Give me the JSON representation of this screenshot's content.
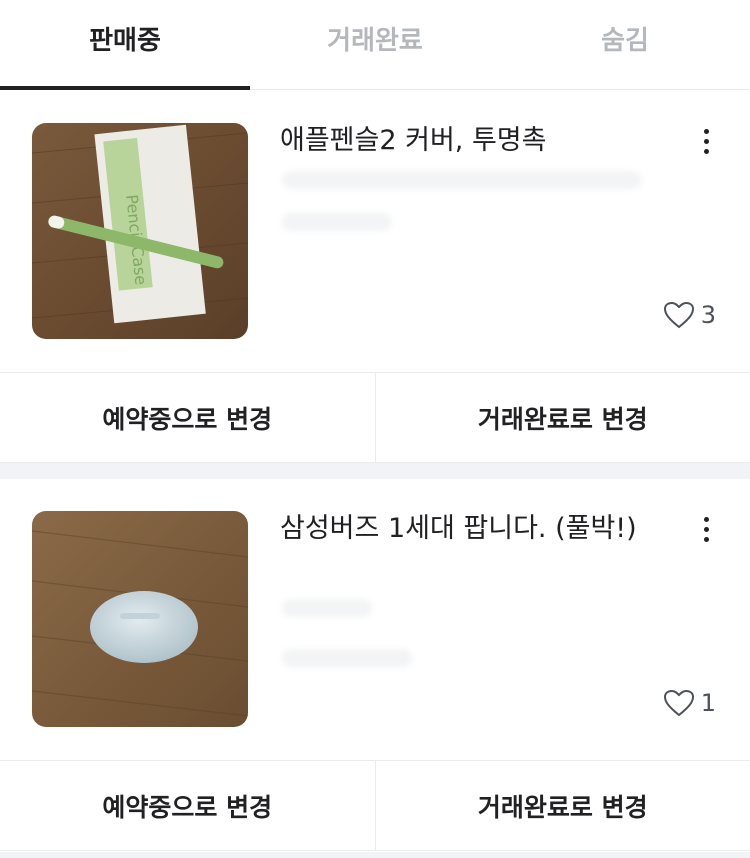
{
  "tabs": [
    {
      "label": "판매중",
      "active": true
    },
    {
      "label": "거래완료",
      "active": false
    },
    {
      "label": "숨김",
      "active": false
    }
  ],
  "items": [
    {
      "title": "애플펜슬2 커버, 투명촉",
      "likes": "3",
      "image_icon": "pencil-case-photo",
      "actions": {
        "reserve": "예약중으로 변경",
        "complete": "거래완료로 변경"
      }
    },
    {
      "title": "삼성버즈 1세대 팝니다. (풀박!)",
      "likes": "1",
      "image_icon": "earbuds-case-photo",
      "actions": {
        "reserve": "예약중으로 변경",
        "complete": "거래완료로 변경"
      }
    }
  ],
  "colors": {
    "text": "#212124",
    "inactive_tab": "#b4b8bd",
    "divider": "#e9ecef",
    "band": "#f2f3f6"
  }
}
